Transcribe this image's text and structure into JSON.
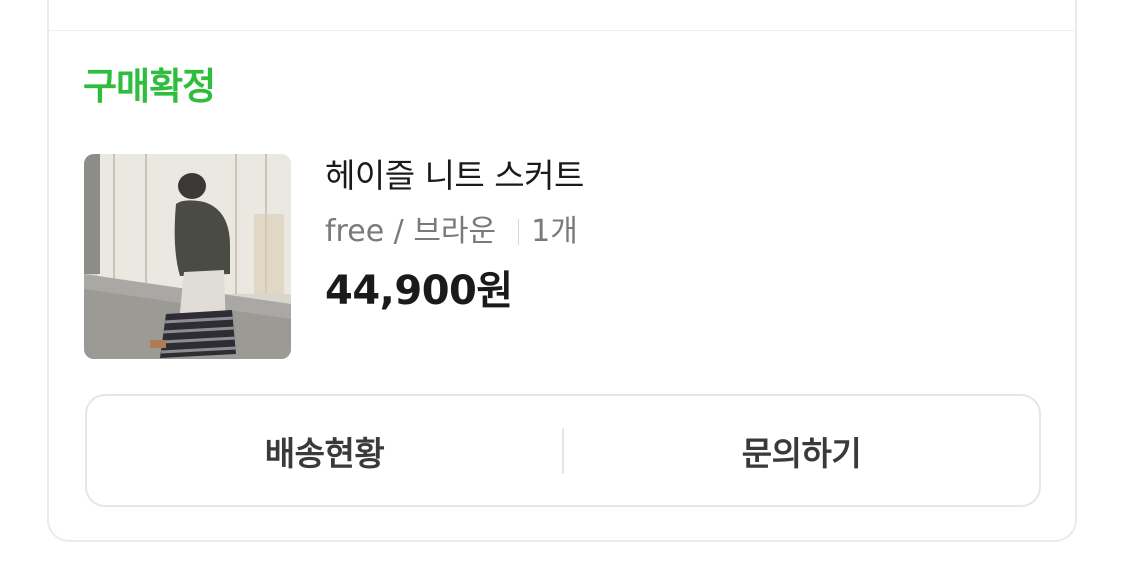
{
  "order": {
    "status_label": "구매확정",
    "status_color": "#2ebd3d",
    "product": {
      "thumbnail_icon": "product-photo",
      "name": "헤이즐 니트 스커트",
      "option": "free / 브라운",
      "quantity": "1개",
      "price": "44,900원"
    },
    "actions": {
      "delivery_label": "배송현황",
      "inquiry_label": "문의하기"
    }
  }
}
